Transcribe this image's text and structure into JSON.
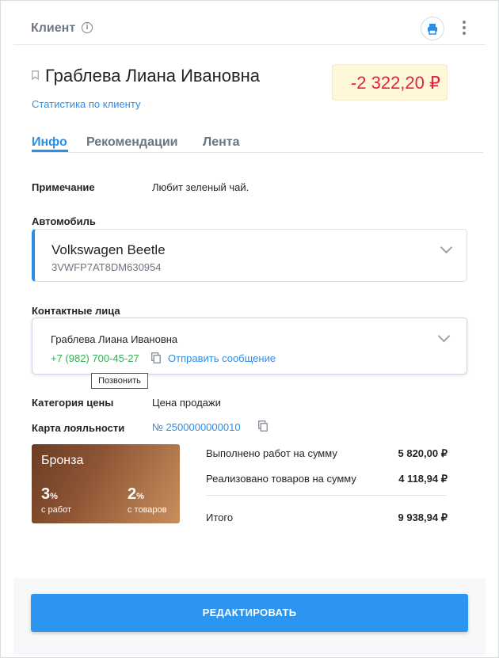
{
  "header": {
    "title": "Клиент",
    "info_icon": "info-icon",
    "print_icon": "printer-icon",
    "more_icon": "more-vertical-icon"
  },
  "client": {
    "name": "Граблева Лиана Ивановна",
    "stats_link": "Статистика по клиенту",
    "balance": "-2 322,20 ₽",
    "balance_color": "#e2243b"
  },
  "tabs": [
    {
      "label": "Инфо",
      "active": true
    },
    {
      "label": "Рекомендации",
      "active": false
    },
    {
      "label": "Лента",
      "active": false
    }
  ],
  "note": {
    "label": "Примечание",
    "value": "Любит зеленый чай."
  },
  "car": {
    "label": "Автомобиль",
    "model": "Volkswagen Beetle",
    "vin": "3VWFP7AT8DM630954"
  },
  "contacts": {
    "label": "Контактные лица",
    "name": "Граблева Лиана Ивановна",
    "phone": "+7 (982) 700-45-27",
    "send_message": "Отправить сообщение",
    "tooltip": "Позвонить"
  },
  "price_category": {
    "label": "Категория цены",
    "value": "Цена продажи"
  },
  "loyalty": {
    "label": "Карта лояльности",
    "number": "№ 2500000000010"
  },
  "bronze_card": {
    "title": "Бронза",
    "works_value": "3",
    "works_unit": "%",
    "works_caption": "с работ",
    "goods_value": "2",
    "goods_unit": "%",
    "goods_caption": "с товаров"
  },
  "summary": {
    "works_label": "Выполнено работ на сумму",
    "works_value": "5 820,00 ₽",
    "goods_label": "Реализовано товаров на сумму",
    "goods_value": "4 118,94 ₽",
    "total_label": "Итого",
    "total_value": "9 938,94 ₽"
  },
  "actions": {
    "edit": "РЕДАКТИРОВАТЬ"
  },
  "colors": {
    "accent": "#2a8ee8",
    "phone": "#2eb34f",
    "button": "#2b95ef"
  }
}
